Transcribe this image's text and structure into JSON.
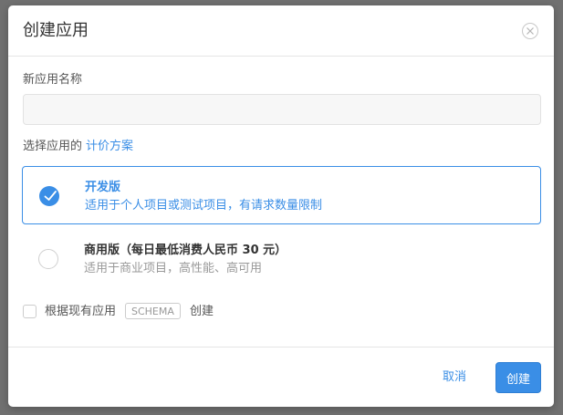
{
  "dialog": {
    "title": "创建应用",
    "close_icon": "close-icon"
  },
  "name_field": {
    "label": "新应用名称",
    "value": "",
    "placeholder": ""
  },
  "plan_section": {
    "label": "选择应用的",
    "link": "计价方案"
  },
  "plans": [
    {
      "name": "开发版",
      "description": "适用于个人项目或测试项目，有请求数量限制",
      "selected": true
    },
    {
      "name": "商用版（每日最低消费人民币 30 元）",
      "description": "适用于商业项目，高性能、高可用",
      "selected": false
    }
  ],
  "schema_option": {
    "checked": false,
    "text_before": "根据现有应用",
    "tag": "SCHEMA",
    "text_after": "创建"
  },
  "footer": {
    "cancel_label": "取消",
    "create_label": "创建"
  },
  "colors": {
    "accent": "#3a8ee6",
    "backdrop": "#707070",
    "muted_text": "#999999"
  }
}
